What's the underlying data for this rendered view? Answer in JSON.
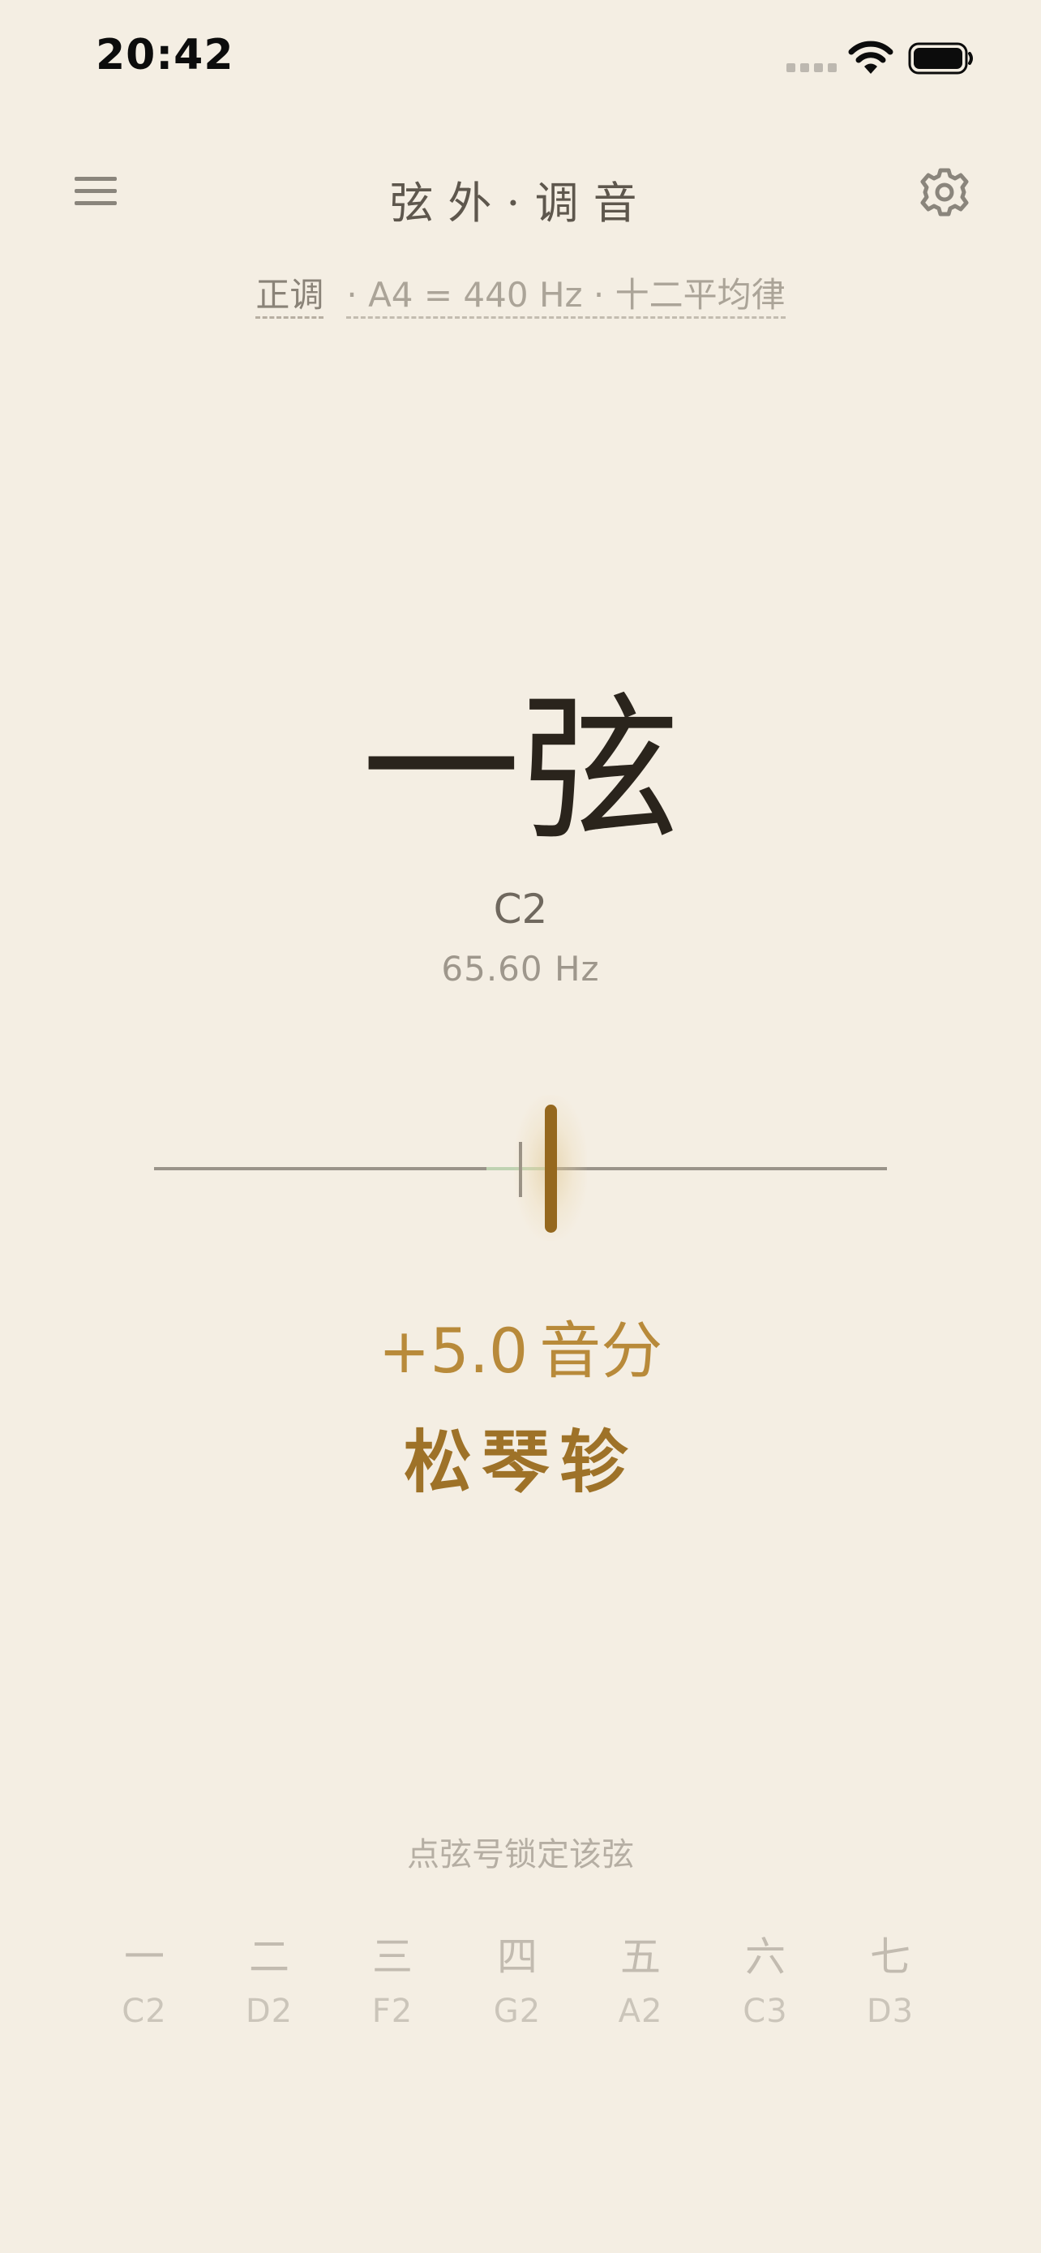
{
  "status_bar": {
    "time": "20:42",
    "signal_icon": "cellular-signal-icon",
    "wifi_icon": "wifi-icon",
    "battery_icon": "battery-icon"
  },
  "header": {
    "menu_icon": "hamburger-menu-icon",
    "title": "弦外·调音",
    "settings_icon": "gear-icon"
  },
  "mode": {
    "temperament": "正调",
    "pitch_line": "· A4 = 440 Hz · 十二平均律"
  },
  "current": {
    "string_name": "一弦",
    "note": "C2",
    "frequency": "65.60 Hz",
    "cents_value": "+5.0",
    "cents_unit": "音分",
    "instruction": "松琴轸",
    "needle_cents": 5.0
  },
  "hint": "点弦号锁定该弦",
  "strings": [
    {
      "num": "一",
      "pitch": "C2"
    },
    {
      "num": "二",
      "pitch": "D2"
    },
    {
      "num": "三",
      "pitch": "F2"
    },
    {
      "num": "四",
      "pitch": "G2"
    },
    {
      "num": "五",
      "pitch": "A2"
    },
    {
      "num": "六",
      "pitch": "C3"
    },
    {
      "num": "七",
      "pitch": "D3"
    }
  ],
  "colors": {
    "background": "#F4EEE3",
    "accent": "#B88A3A",
    "needle": "#95681E",
    "in_tune_zone": "#BFD2B2"
  }
}
